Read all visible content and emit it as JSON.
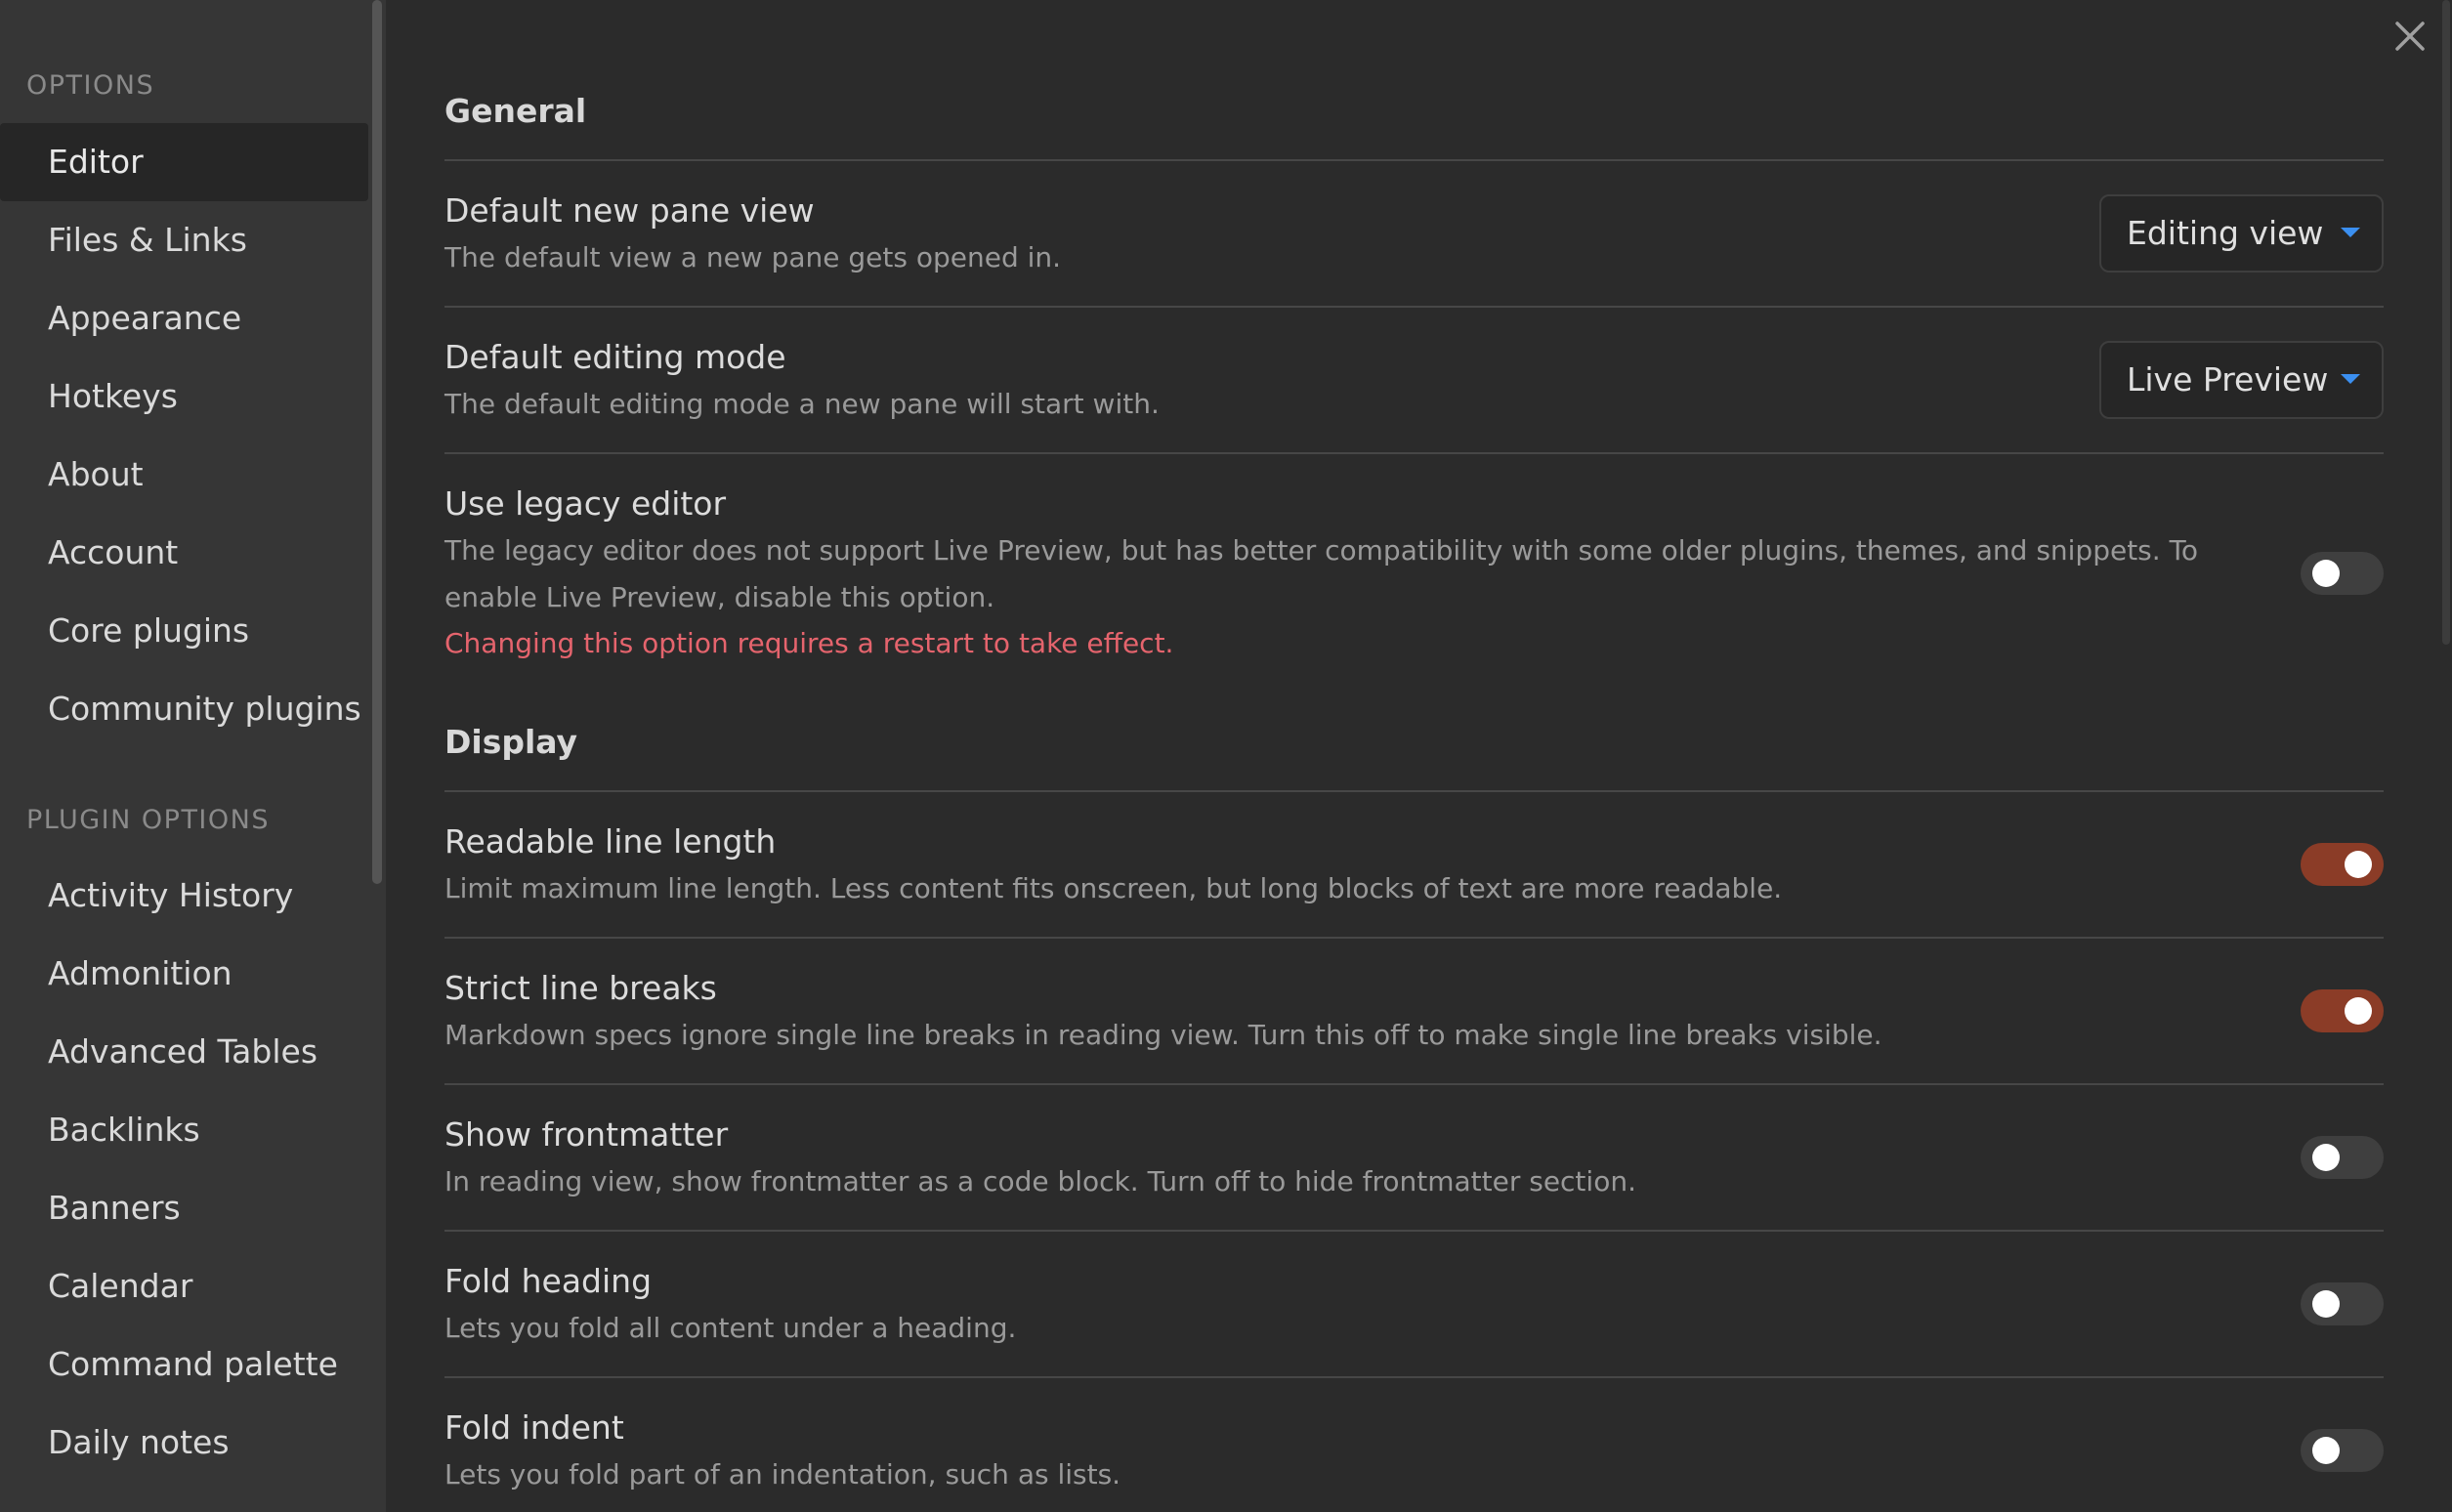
{
  "sidebar": {
    "options_heading": "OPTIONS",
    "plugin_options_heading": "PLUGIN OPTIONS",
    "options_items": [
      {
        "label": "Editor",
        "active": true
      },
      {
        "label": "Files & Links"
      },
      {
        "label": "Appearance"
      },
      {
        "label": "Hotkeys"
      },
      {
        "label": "About"
      },
      {
        "label": "Account"
      },
      {
        "label": "Core plugins"
      },
      {
        "label": "Community plugins"
      }
    ],
    "plugin_items": [
      {
        "label": "Activity History"
      },
      {
        "label": "Admonition"
      },
      {
        "label": "Advanced Tables"
      },
      {
        "label": "Backlinks"
      },
      {
        "label": "Banners"
      },
      {
        "label": "Calendar"
      },
      {
        "label": "Command palette"
      },
      {
        "label": "Daily notes"
      }
    ]
  },
  "sections": {
    "general": "General",
    "display": "Display"
  },
  "settings": {
    "default_pane_view": {
      "name": "Default new pane view",
      "desc": "The default view a new pane gets opened in.",
      "value": "Editing view"
    },
    "default_editing_mode": {
      "name": "Default editing mode",
      "desc": "The default editing mode a new pane will start with.",
      "value": "Live Preview"
    },
    "legacy_editor": {
      "name": "Use legacy editor",
      "desc": "The legacy editor does not support Live Preview, but has better compatibility with some older plugins, themes, and snippets. To enable Live Preview, disable this option.",
      "warning": "Changing this option requires a restart to take effect.",
      "enabled": false
    },
    "readable_line_length": {
      "name": "Readable line length",
      "desc": "Limit maximum line length. Less content fits onscreen, but long blocks of text are more readable.",
      "enabled": true
    },
    "strict_line_breaks": {
      "name": "Strict line breaks",
      "desc": "Markdown specs ignore single line breaks in reading view. Turn this off to make single line breaks visible.",
      "enabled": true
    },
    "show_frontmatter": {
      "name": "Show frontmatter",
      "desc": "In reading view, show frontmatter as a code block. Turn off to hide frontmatter section.",
      "enabled": false
    },
    "fold_heading": {
      "name": "Fold heading",
      "desc": "Lets you fold all content under a heading.",
      "enabled": false
    },
    "fold_indent": {
      "name": "Fold indent",
      "desc": "Lets you fold part of an indentation, such as lists.",
      "enabled": false
    }
  },
  "colors": {
    "toggle_on": "#8b3c27",
    "toggle_off": "#3f3f3f",
    "warning": "#e5646d",
    "dropdown_arrow": "#3b8ff0"
  },
  "icons": {
    "close": "close-icon",
    "dropdown": "chevron-down-icon"
  }
}
